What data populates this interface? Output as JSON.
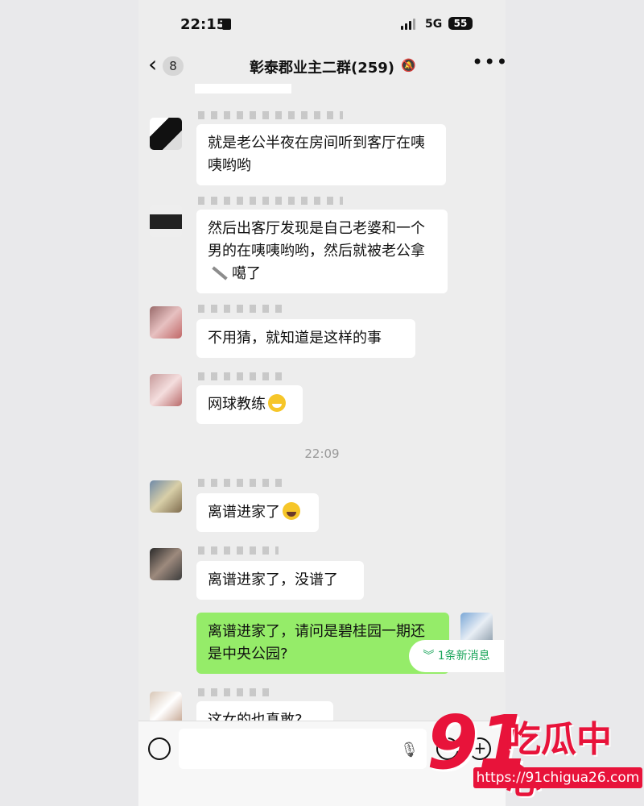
{
  "status": {
    "time": "22:15",
    "network": "5G",
    "battery": "55"
  },
  "nav": {
    "badge": "8",
    "title": "彰泰郡业主二群(259)"
  },
  "messages": [
    {
      "text": "就是老公半夜在房间听到客厅在咦咦哟哟"
    },
    {
      "text_before": "然后出客厅发现是自己老婆和一个男的在咦咦哟哟，然后就被老公拿",
      "text_after": "噶了"
    },
    {
      "text": "不用猜，就知道是这样的事"
    },
    {
      "text": "网球教练"
    },
    {
      "timestamp": "22:09"
    },
    {
      "text": "离谱进家了"
    },
    {
      "text": "离谱进家了，没谱了"
    },
    {
      "text": "离谱进家了，请问是碧桂园一期还是中央公园?",
      "sender": "me"
    },
    {
      "text": "这女的也真敢?"
    }
  ],
  "new_messages": "1条新消息",
  "watermark": {
    "number": "91",
    "name": "吃瓜中心",
    "url": "https://91chigua26.com"
  }
}
